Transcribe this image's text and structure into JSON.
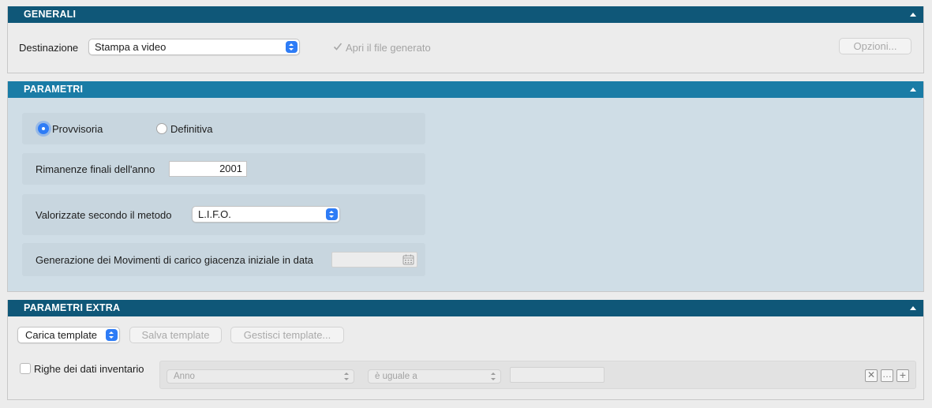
{
  "generali": {
    "title": "GENERALI",
    "destinazione_label": "Destinazione",
    "destinazione_value": "Stampa a video",
    "apri_file_label": "Apri il file generato",
    "apri_file_checked": true,
    "opzioni_label": "Opzioni..."
  },
  "parametri": {
    "title": "PARAMETRI",
    "radio_provvisoria": "Provvisoria",
    "radio_definitiva": "Definitiva",
    "selected": "Provvisoria",
    "rimanenze_label": "Rimanenze finali dell'anno",
    "rimanenze_value": "2001",
    "metodo_label": "Valorizzate secondo il metodo",
    "metodo_value": "L.I.F.O.",
    "generazione_label": "Generazione dei Movimenti di carico giacenza iniziale in data",
    "generazione_value": ""
  },
  "extra": {
    "title": "PARAMETRI EXTRA",
    "carica_label": "Carica template",
    "salva_label": "Salva template",
    "gestisci_label": "Gestisci template...",
    "righe_label": "Righe dei dati inventario",
    "righe_checked": false,
    "field_value": "Anno",
    "operator_value": "è uguale a",
    "filter_value": ""
  },
  "colors": {
    "header_dark": "#0f5778",
    "header_light": "#1a7ca6",
    "accent": "#2e7cf6",
    "subpanel_bg": "#c8d6df"
  }
}
